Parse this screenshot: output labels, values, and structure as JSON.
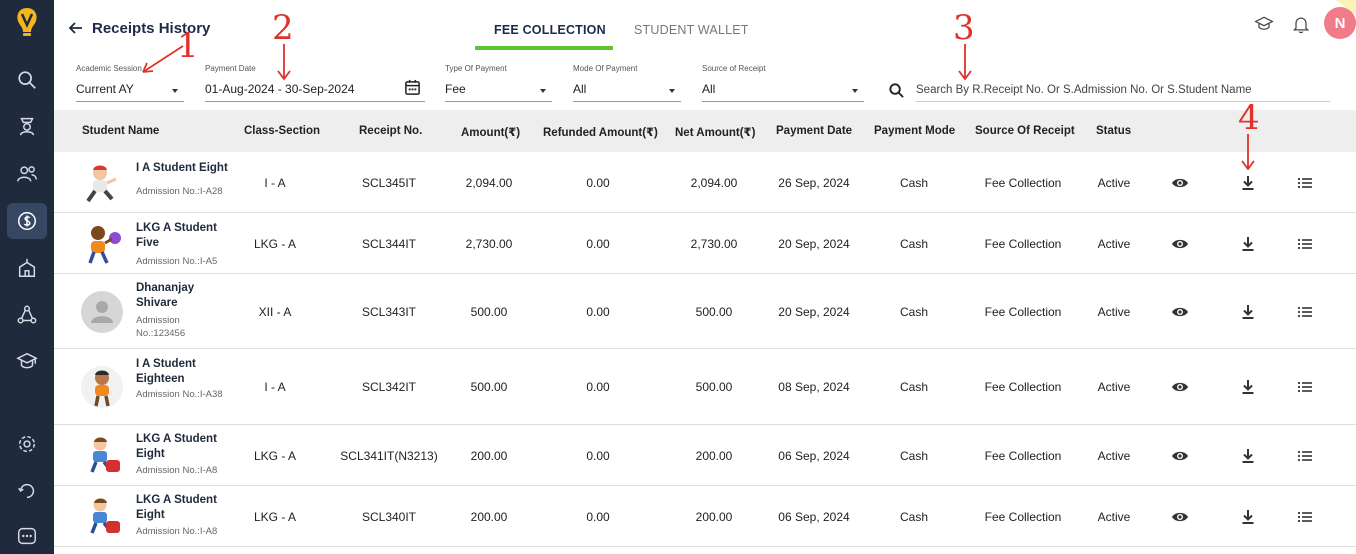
{
  "header": {
    "title": "Receipts History",
    "tabs": [
      {
        "label": "FEE COLLECTION",
        "active": true
      },
      {
        "label": "STUDENT WALLET",
        "active": false
      }
    ],
    "avatar_initial": "N"
  },
  "filters": {
    "academic_session": {
      "label": "Academic Session",
      "value": "Current AY"
    },
    "payment_date": {
      "label": "Payment Date",
      "value": "01-Aug-2024 - 30-Sep-2024"
    },
    "type_of_payment": {
      "label": "Type Of Payment",
      "value": "Fee"
    },
    "mode_of_payment": {
      "label": "Mode Of Payment",
      "value": "All"
    },
    "source_of_receipt": {
      "label": "Source of Receipt",
      "value": "All"
    }
  },
  "search": {
    "placeholder": "Search By R.Receipt No. Or S.Admission No. Or S.Student Name"
  },
  "table": {
    "columns": [
      "Student Name",
      "Class-Section",
      "Receipt No.",
      "Amount(₹)",
      "Refunded Amount(₹)",
      "Net Amount(₹)",
      "Payment Date",
      "Payment Mode",
      "Source Of Receipt",
      "Status"
    ],
    "rows": [
      {
        "name": "I A Student Eight",
        "admission": "Admission No.:I-A28",
        "class_section": "I - A",
        "receipt_no": "SCL345IT",
        "amount": "2,094.00",
        "refunded": "0.00",
        "net": "2,094.00",
        "date": "26 Sep, 2024",
        "mode": "Cash",
        "source": "Fee Collection",
        "status": "Active",
        "avatar": "cartoon-running"
      },
      {
        "name": "LKG A Student Five",
        "admission": "Admission No.:I-A5",
        "class_section": "LKG - A",
        "receipt_no": "SCL344IT",
        "amount": "2,730.00",
        "refunded": "0.00",
        "net": "2,730.00",
        "date": "20 Sep, 2024",
        "mode": "Cash",
        "source": "Fee Collection",
        "status": "Active",
        "avatar": "cartoon-kid"
      },
      {
        "name": "Dhananjay Shivare",
        "admission": "Admission No.:123456",
        "class_section": "XII - A",
        "receipt_no": "SCL343IT",
        "amount": "500.00",
        "refunded": "0.00",
        "net": "500.00",
        "date": "20 Sep, 2024",
        "mode": "Cash",
        "source": "Fee Collection",
        "status": "Active",
        "avatar": "placeholder"
      },
      {
        "name": "I A Student Eighteen",
        "admission": "Admission No.:I-A38",
        "class_section": "I - A",
        "receipt_no": "SCL342IT",
        "amount": "500.00",
        "refunded": "0.00",
        "net": "500.00",
        "date": "08 Sep, 2024",
        "mode": "Cash",
        "source": "Fee Collection",
        "status": "Active",
        "avatar": "cartoon-boy"
      },
      {
        "name": "LKG A Student Eight",
        "admission": "Admission No.:I-A8",
        "class_section": "LKG - A",
        "receipt_no": "SCL341IT(N3213)",
        "amount": "200.00",
        "refunded": "0.00",
        "net": "200.00",
        "date": "06 Sep, 2024",
        "mode": "Cash",
        "source": "Fee Collection",
        "status": "Active",
        "avatar": "cartoon-bag"
      },
      {
        "name": "LKG A Student Eight",
        "admission": "Admission No.:I-A8",
        "class_section": "LKG - A",
        "receipt_no": "SCL340IT",
        "amount": "200.00",
        "refunded": "0.00",
        "net": "200.00",
        "date": "06 Sep, 2024",
        "mode": "Cash",
        "source": "Fee Collection",
        "status": "Active",
        "avatar": "cartoon-bag"
      }
    ]
  },
  "annotations": [
    "1",
    "2",
    "3",
    "4"
  ],
  "sidebar": {
    "items": [
      "logo",
      "search-icon",
      "graduation-cap-student-icon",
      "users-icon",
      "fee-dollar-icon",
      "school-icon",
      "network-icon",
      "hat-icon",
      "settings-icon",
      "refresh-icon",
      "chat-icon"
    ]
  },
  "colors": {
    "sidebar": "#1f2a3d",
    "sidebar_active": "#364763",
    "tab_underline": "#5ac531",
    "annotation": "#e0322b",
    "avatar": "#f27b8a"
  }
}
